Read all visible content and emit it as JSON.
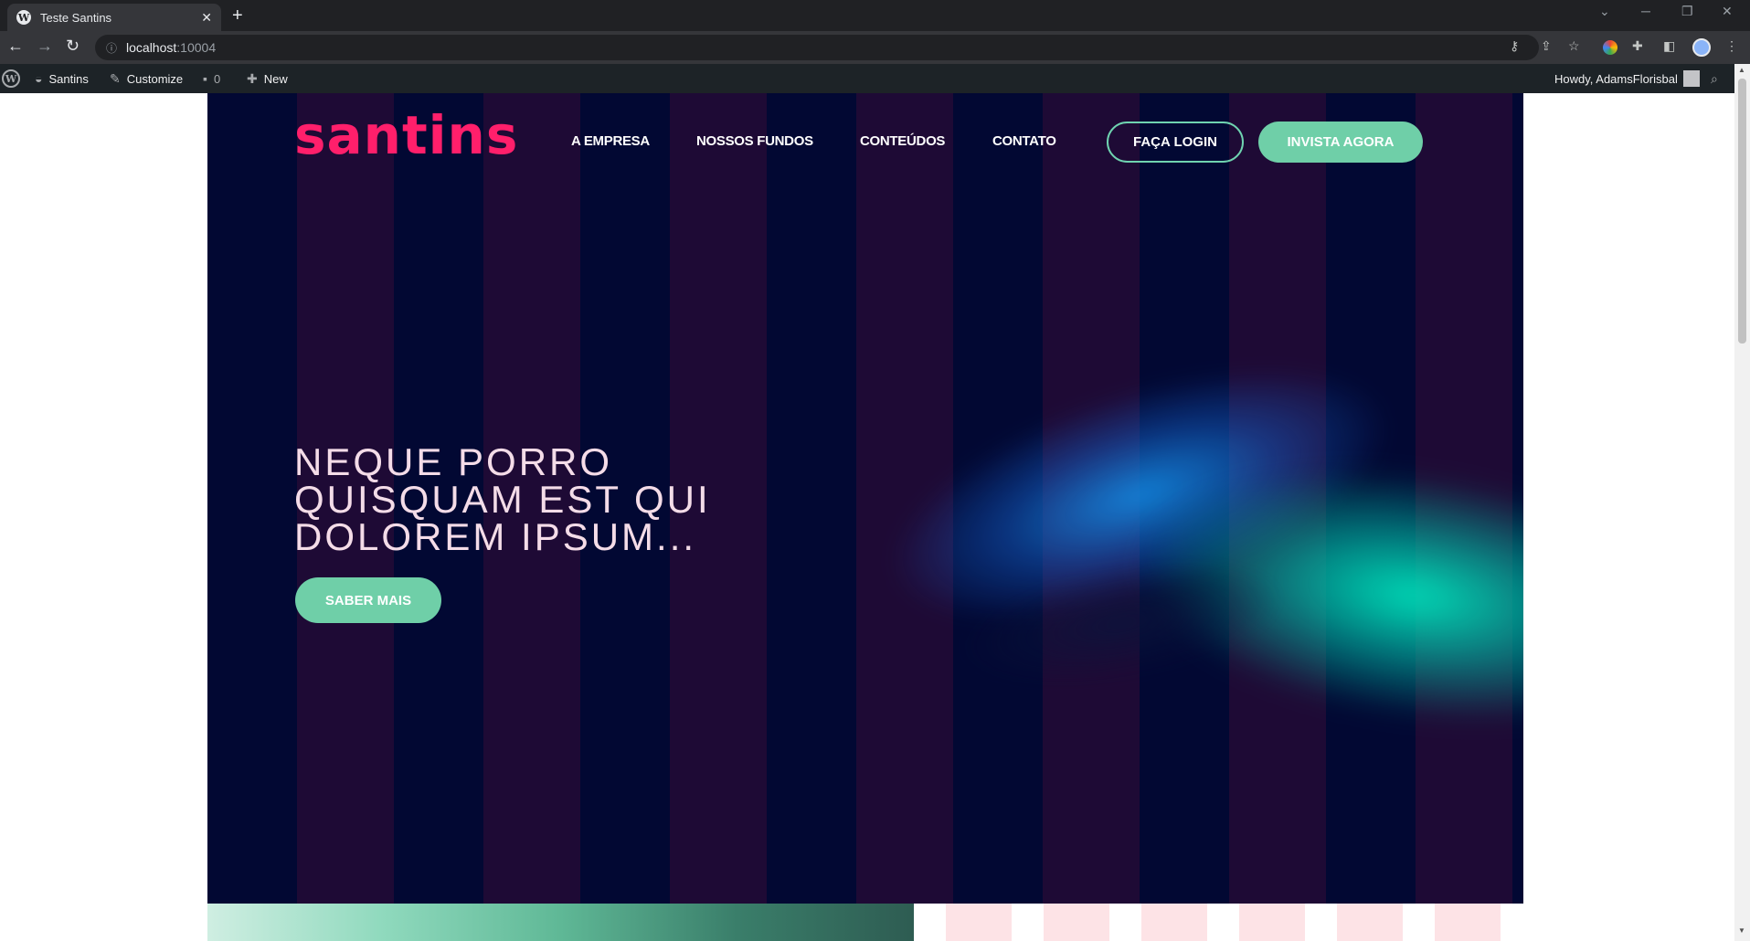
{
  "browser": {
    "tab_title": "Teste Santins",
    "tab_close": "✕",
    "new_tab": "+",
    "url_host": "localhost",
    "url_port": ":10004",
    "icons": [
      "back-arrow-icon",
      "forward-arrow-icon",
      "reload-icon",
      "site-info-icon",
      "key-icon",
      "share-icon",
      "star-icon",
      "extension-icon",
      "puzzle-icon",
      "sidebar-icon",
      "profile-avatar",
      "menu-dots-icon"
    ]
  },
  "wp_admin_bar": {
    "site_name": "Santins",
    "customize": "Customize",
    "comments_count": "0",
    "new_label": "New",
    "howdy": "Howdy, AdamsFlorisbal"
  },
  "site": {
    "logo": "santins",
    "nav": [
      "A EMPRESA",
      "NOSSOS FUNDOS",
      "CONTEÚDOS",
      "CONTATO"
    ],
    "login_button": "FAÇA LOGIN",
    "invest_button": "INVISTA AGORA",
    "hero_title_lines": [
      "NEQUE PORRO",
      "QUISQUAM EST QUI",
      "DOLOREM IPSUM..."
    ],
    "cta_button": "SABER MAIS"
  },
  "colors": {
    "brand_pink": "#ff1f6b",
    "accent_green": "#6fcfa8",
    "hero_bg": "#020833",
    "hero_stripe": "#1e0a35",
    "hero_text": "#f4dce8"
  }
}
